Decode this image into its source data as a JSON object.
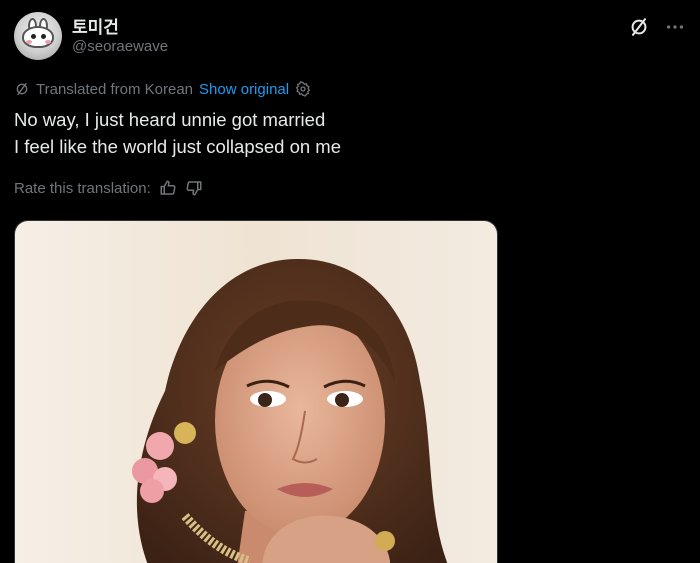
{
  "user": {
    "display_name": "토미건",
    "handle": "@seoraewave"
  },
  "translation": {
    "label": "Translated from Korean",
    "show_original": "Show original"
  },
  "tweet": {
    "lines": [
      "No way, I just heard unnie got married",
      "I feel like the world just collapsed on me"
    ]
  },
  "rating": {
    "label": "Rate this translation:"
  },
  "icons": {
    "grok": "grok-icon",
    "more": "more-icon",
    "translate": "translate-icon",
    "settings": "gear-icon",
    "thumbs_up": "thumbs-up-icon",
    "thumbs_down": "thumbs-down-icon"
  },
  "colors": {
    "background": "#000000",
    "text": "#e7e9ea",
    "secondary": "#71767b",
    "link": "#1d9bf0"
  }
}
